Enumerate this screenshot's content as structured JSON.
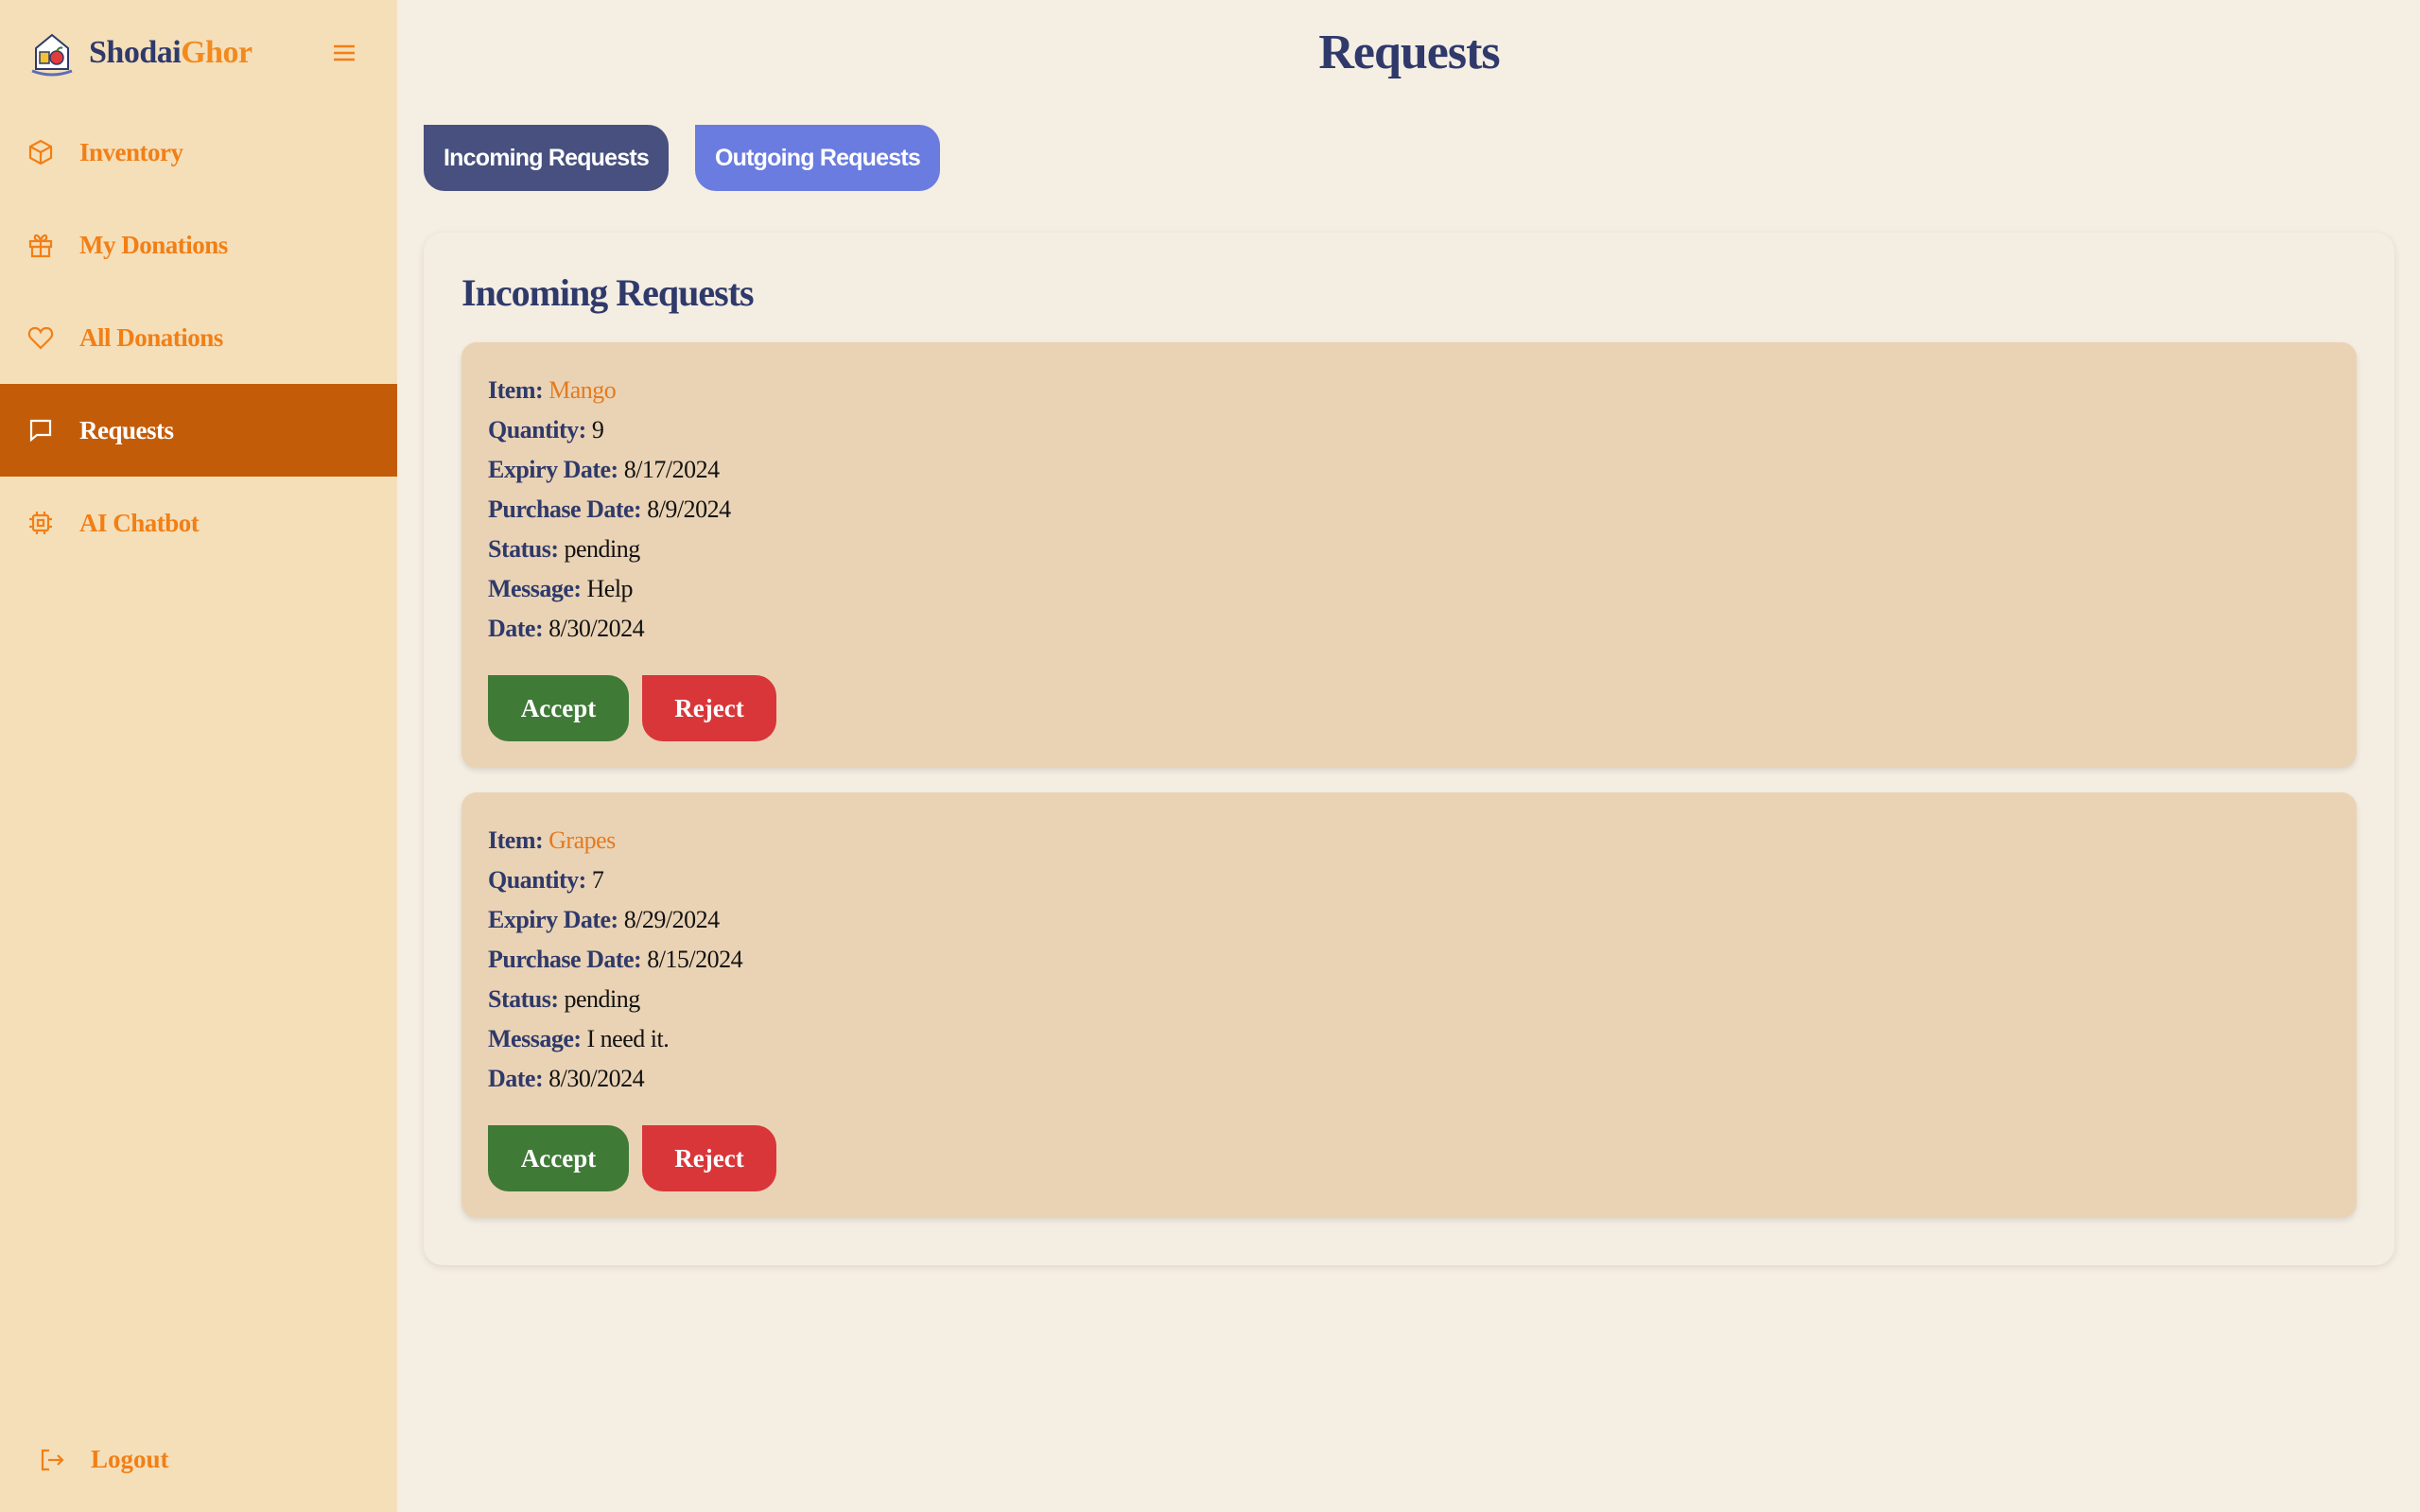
{
  "brand": {
    "name_part1": "Shodai",
    "name_part2": "Ghor"
  },
  "sidebar": {
    "items": [
      {
        "label": "Inventory",
        "icon": "box-icon"
      },
      {
        "label": "My Donations",
        "icon": "gift-icon"
      },
      {
        "label": "All Donations",
        "icon": "heart-icon"
      },
      {
        "label": "Requests",
        "icon": "chat-icon",
        "active": true
      },
      {
        "label": "AI Chatbot",
        "icon": "chip-icon"
      }
    ],
    "logout_label": "Logout"
  },
  "page": {
    "title": "Requests"
  },
  "tabs": {
    "incoming": "Incoming Requests",
    "outgoing": "Outgoing Requests"
  },
  "panel": {
    "title": "Incoming Requests"
  },
  "labels": {
    "item": "Item:",
    "quantity": "Quantity:",
    "expiry": "Expiry Date:",
    "purchase": "Purchase Date:",
    "status": "Status:",
    "message": "Message:",
    "date": "Date:",
    "accept": "Accept",
    "reject": "Reject"
  },
  "requests": [
    {
      "item": "Mango",
      "quantity": "9",
      "expiry": "8/17/2024",
      "purchase": "8/9/2024",
      "status": "pending",
      "message": "Help",
      "date": "8/30/2024"
    },
    {
      "item": "Grapes",
      "quantity": "7",
      "expiry": "8/29/2024",
      "purchase": "8/15/2024",
      "status": "pending",
      "message": "I need it.",
      "date": "8/30/2024"
    }
  ],
  "colors": {
    "sidebar_bg": "#f5dfb9",
    "active_nav": "#c35c09",
    "accent_orange": "#f27f16",
    "navy": "#2f3a6b",
    "accept_green": "#3f7a36",
    "reject_red": "#d9363a",
    "tab_incoming": "#47507f",
    "tab_outgoing": "#6a7cdf"
  }
}
